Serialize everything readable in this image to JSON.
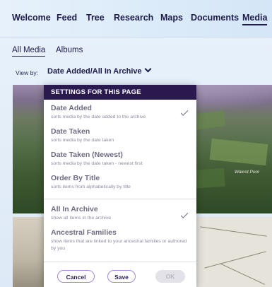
{
  "topnav": {
    "items": [
      "Welcome",
      "Feed",
      "Tree",
      "Research",
      "Maps",
      "Documents",
      "Media"
    ],
    "active": "Media"
  },
  "subnav": {
    "tabs": [
      "All Media",
      "Albums"
    ],
    "active": "All Media"
  },
  "view_by": {
    "label": "View by:",
    "value": "Date Added/All In Archive"
  },
  "thumbnails": {
    "aerial_labels": [
      "Walcot Pool"
    ]
  },
  "settings_panel": {
    "header": "SETTINGS FOR THIS PAGE",
    "sort_options": [
      {
        "title": "Date Added",
        "desc": "sorts media by the date added to the archive",
        "selected": true
      },
      {
        "title": "Date Taken",
        "desc": "sorts media by the date taken",
        "selected": false
      },
      {
        "title": "Date Taken (Newest)",
        "desc": "sorts media by the date taken - newest first",
        "selected": false
      },
      {
        "title": "Order By Title",
        "desc": "sorts items from alphabetically by title",
        "selected": false
      }
    ],
    "filter_options": [
      {
        "title": "All In Archive",
        "desc": "show all items in the archive",
        "selected": true
      },
      {
        "title": "Ancestral Families",
        "desc": "show items that are linked to your ancestral families or authored by you",
        "selected": false
      }
    ],
    "buttons": {
      "cancel": "Cancel",
      "save": "Save",
      "ok": "OK"
    }
  },
  "colors": {
    "header_bg": "#29194f",
    "accent_outline": "#a48ad8",
    "nav_text": "#1d1b4a"
  }
}
